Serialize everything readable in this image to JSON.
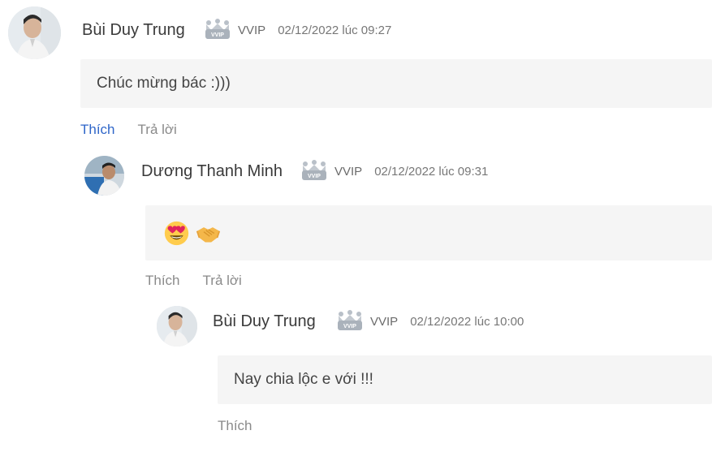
{
  "comments": [
    {
      "author": "Bùi Duy Trung",
      "tier": "VVIP",
      "timestamp": "02/12/2022 lúc 09:27",
      "text": "Chúc mừng bác :)))",
      "actions": {
        "like": "Thích",
        "reply": "Trả lời"
      },
      "liked": true
    },
    {
      "author": "Dương Thanh Minh",
      "tier": "VVIP",
      "timestamp": "02/12/2022 lúc 09:31",
      "emojis": [
        "heart-eyes-emoji",
        "handshake-emoji"
      ],
      "actions": {
        "like": "Thích",
        "reply": "Trả lời"
      },
      "liked": false
    },
    {
      "author": "Bùi Duy Trung",
      "tier": "VVIP",
      "timestamp": "02/12/2022 lúc 10:00",
      "text": "Nay chia lộc e với !!!",
      "actions": {
        "like": "Thích"
      },
      "liked": false
    }
  ],
  "icons": {
    "badge": "crown-badge-icon"
  },
  "colors": {
    "liked": "#2f66c9",
    "bubble": "#f5f5f5",
    "muted": "#8a8a8a"
  }
}
